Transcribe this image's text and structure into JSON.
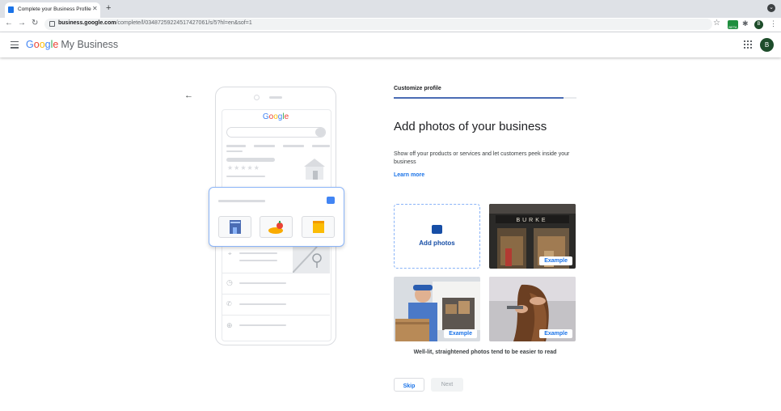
{
  "browser": {
    "tab_title": "Complete your Business Profile",
    "url_host": "business.google.com",
    "url_path": "/complete/l/03487259224517427061/s/5?hl=en&sof=1",
    "profile_initial": "B",
    "badge_text": "BETA"
  },
  "header": {
    "logo_letters": [
      "G",
      "o",
      "o",
      "g",
      "l",
      "e"
    ],
    "logo_suffix": "My Business",
    "avatar_initial": "B"
  },
  "illustration": {
    "search_brand": [
      "G",
      "o",
      "o",
      "g",
      "l",
      "e"
    ],
    "rating_stars": "★★★★★"
  },
  "main": {
    "step_label": "Customize profile",
    "progress_fraction": 0.93,
    "heading": "Add photos of your business",
    "description": "Show off your products or services and let customers peek inside your business",
    "learn_more": "Learn more",
    "add_photos_label": "Add photos",
    "example_label": "Example",
    "storefront_sign": "BURKE",
    "caption": "Well-lit, straightened photos tend to be easier to read",
    "skip_label": "Skip",
    "next_label": "Next"
  },
  "colors": {
    "accent": "#1a73e8",
    "progress": "#4a6cb4",
    "avatar": "#1e4d2b"
  }
}
